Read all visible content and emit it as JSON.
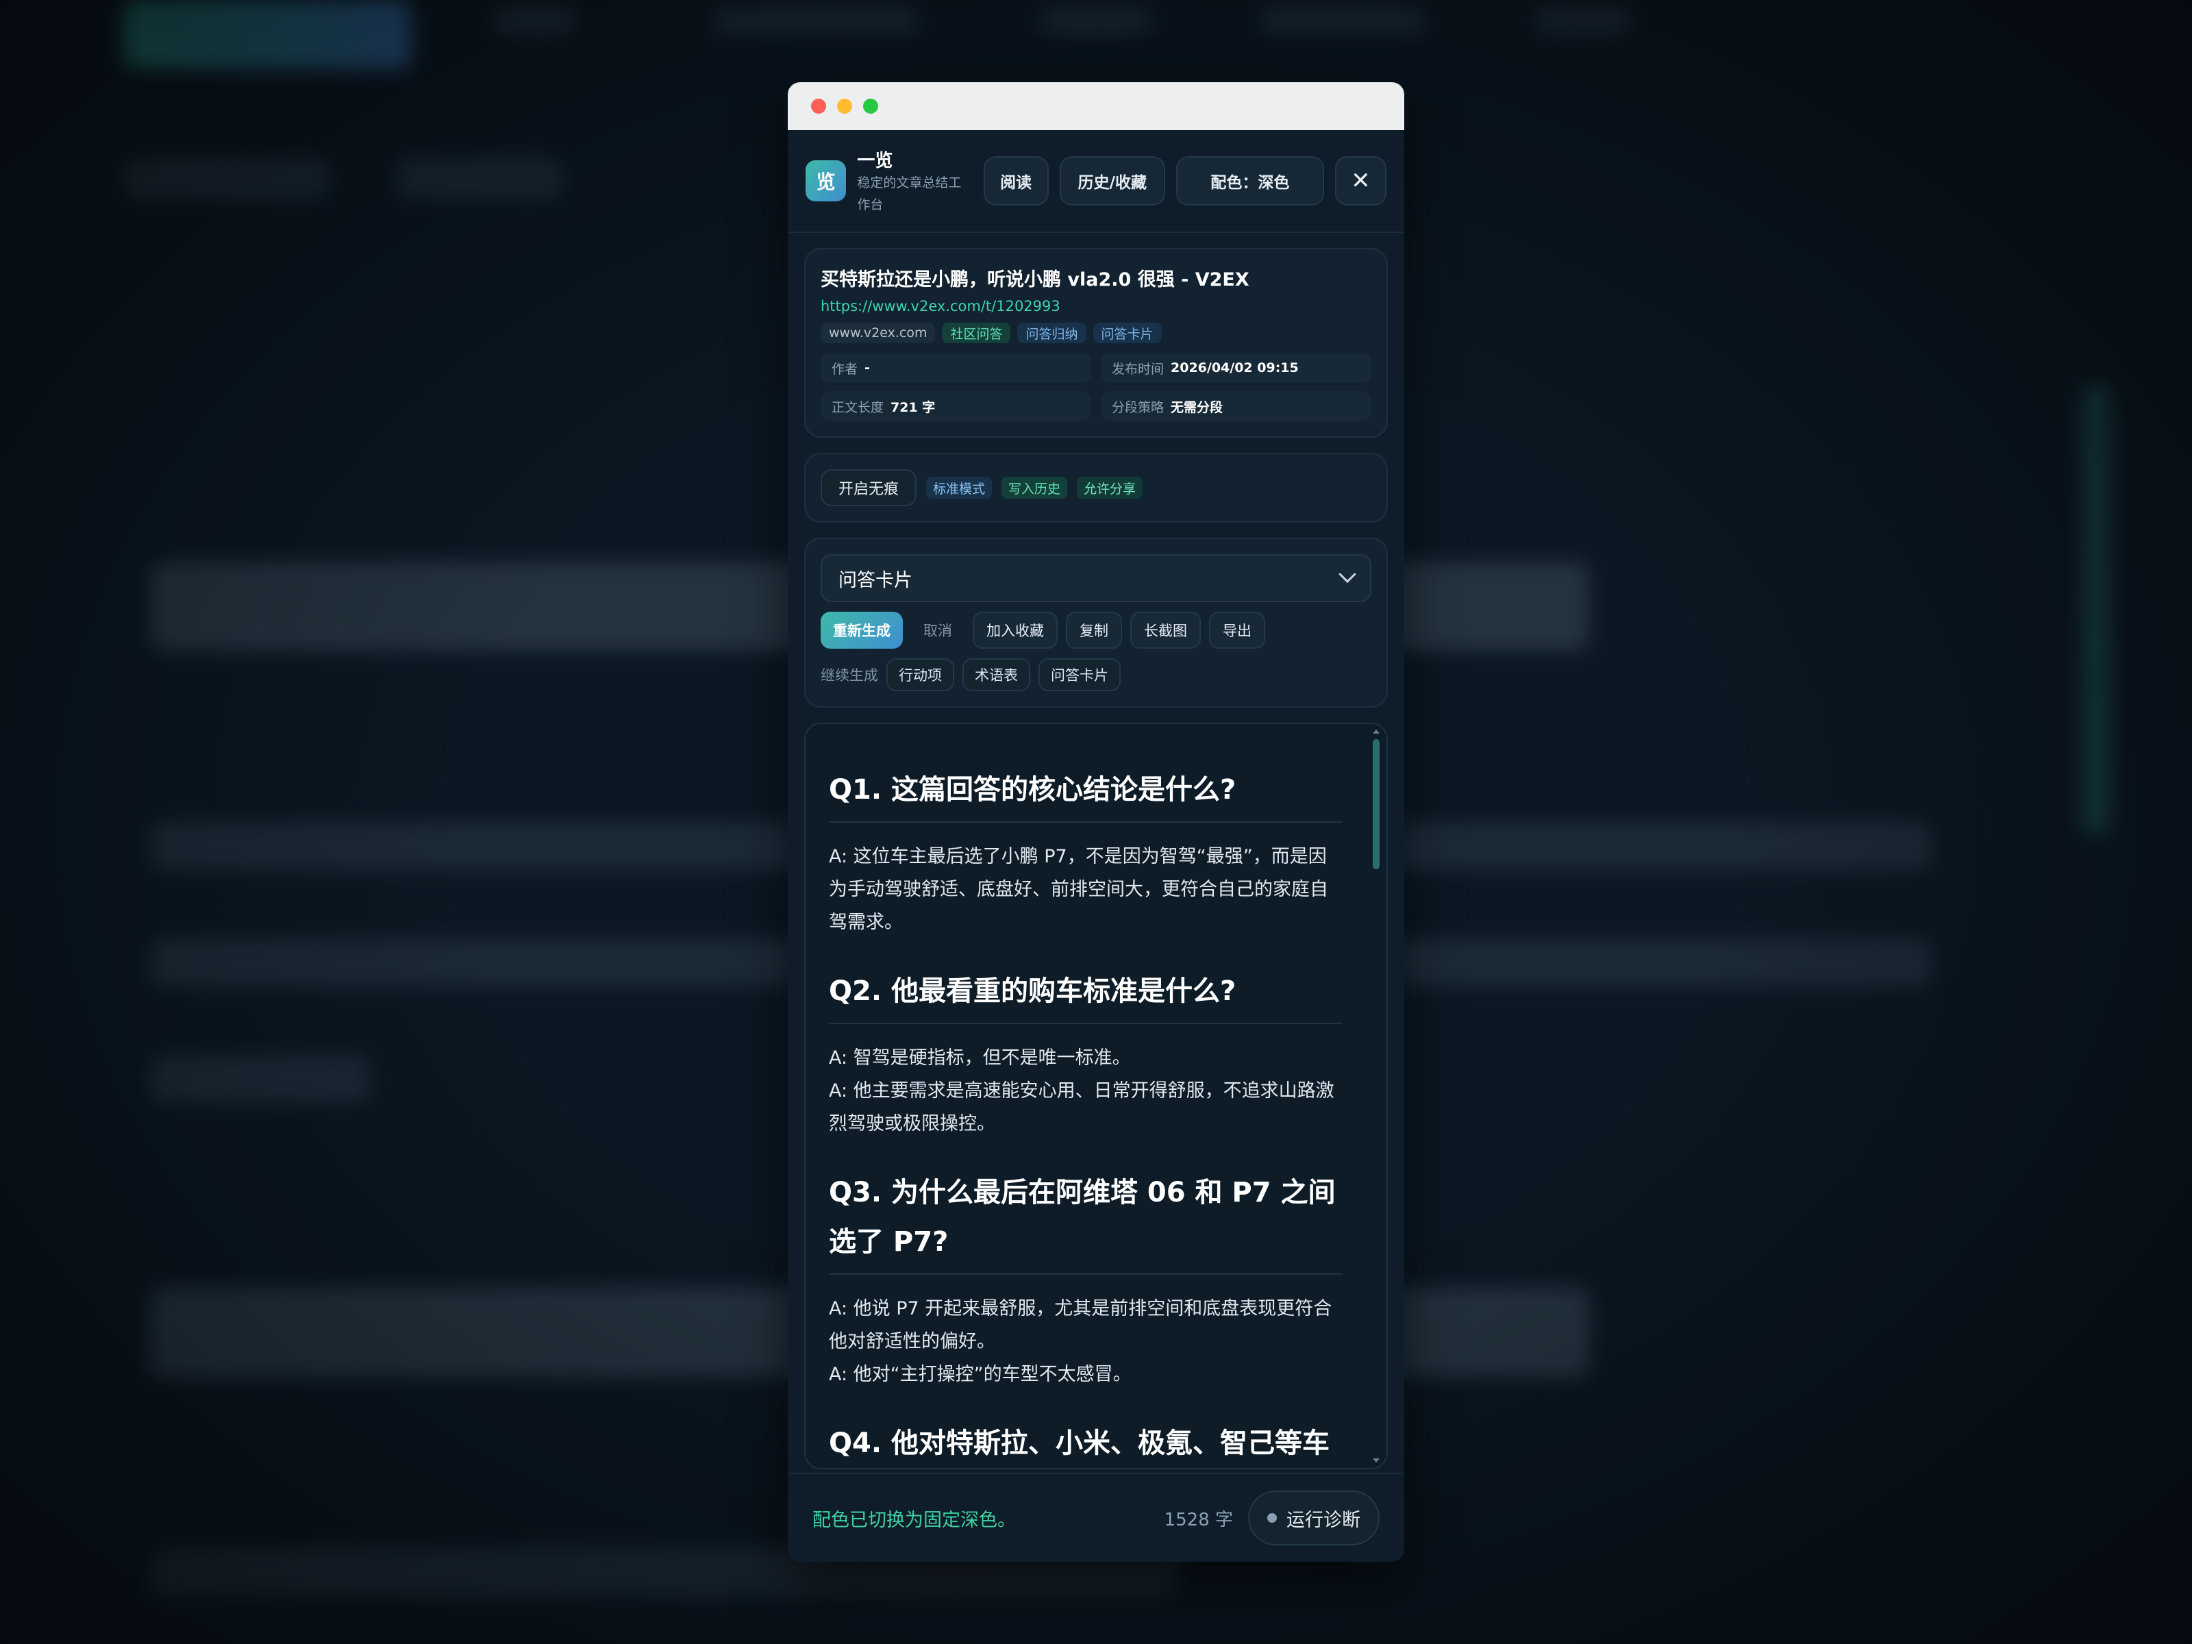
{
  "window": {
    "brand": {
      "logo_char": "览",
      "name": "一览",
      "subtitle": "稳定的文章总结工作台"
    },
    "header_buttons": {
      "read": "阅读",
      "history": "历史/收藏",
      "theme": "配色：深色",
      "close": "✕"
    }
  },
  "article": {
    "title": "买特斯拉还是小鹏，听说小鹏 vla2.0 很强 - V2EX",
    "url": "https://www.v2ex.com/t/1202993",
    "chips": [
      "www.v2ex.com",
      "社区问答",
      "问答归纳",
      "问答卡片"
    ],
    "meta": {
      "author_label": "作者",
      "author_value": "-",
      "published_label": "发布时间",
      "published_value": "2026/04/02 09:15",
      "length_label": "正文长度",
      "length_value": "721 字",
      "segment_label": "分段策略",
      "segment_value": "无需分段"
    }
  },
  "privacy": {
    "incognito_button": "开启无痕",
    "tags": [
      "标准模式",
      "写入历史",
      "允许分享"
    ]
  },
  "generator": {
    "selected_mode": "问答卡片",
    "actions": {
      "regenerate": "重新生成",
      "cancel": "取消",
      "favorite": "加入收藏",
      "copy": "复制",
      "long_image": "长截图",
      "export": "导出"
    },
    "continue_label": "继续生成",
    "continue_options": [
      "行动项",
      "术语表",
      "问答卡片"
    ]
  },
  "content": {
    "qa": [
      {
        "q": "Q1. 这篇回答的核心结论是什么?",
        "a": [
          "A: 这位车主最后选了小鹏 P7，不是因为智驾“最强”，而是因为手动驾驶舒适、底盘好、前排空间大，更符合自己的家庭自驾需求。"
        ]
      },
      {
        "q": "Q2. 他最看重的购车标准是什么?",
        "a": [
          "A: 智驾是硬指标，但不是唯一标准。",
          "A: 他主要需求是高速能安心用、日常开得舒服，不追求山路激烈驾驶或极限操控。"
        ]
      },
      {
        "q": "Q3. 为什么最后在阿维塔 06 和 P7 之间选了 P7?",
        "a": [
          "A: 他说 P7 开起来最舒服，尤其是前排空间和底盘表现更符合他对舒适性的偏好。",
          "A: 他对“主打操控”的车型不太感冒。"
        ]
      },
      {
        "q": "Q4. 他对特斯拉、小米、极氪、智己等车",
        "a": []
      }
    ]
  },
  "footer": {
    "status": "配色已切换为固定深色。",
    "count": "1528 字",
    "diagnose": "运行诊断"
  }
}
